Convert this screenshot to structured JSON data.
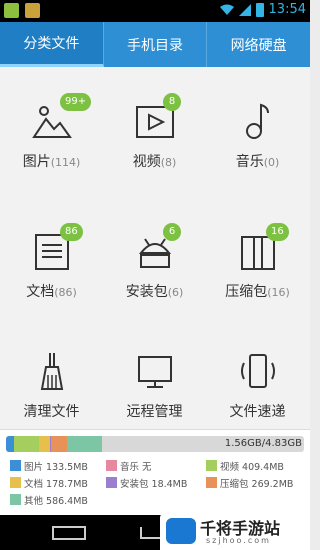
{
  "status_bar": {
    "time": "13:54",
    "icons": [
      "android-icon",
      "app-icon",
      "wifi-icon",
      "signal-icon",
      "battery-icon"
    ]
  },
  "tabs": [
    {
      "label": "分类文件",
      "active": true
    },
    {
      "label": "手机目录",
      "active": false
    },
    {
      "label": "网络硬盘",
      "active": false
    }
  ],
  "categories": [
    {
      "label": "图片",
      "count": "(114)",
      "badge": "99+",
      "icon": "image-icon"
    },
    {
      "label": "视频",
      "count": "(8)",
      "badge": "8",
      "icon": "video-icon"
    },
    {
      "label": "音乐",
      "count": "(0)",
      "badge": "",
      "icon": "music-icon"
    },
    {
      "label": "文档",
      "count": "(86)",
      "badge": "86",
      "icon": "document-icon"
    },
    {
      "label": "安装包",
      "count": "(6)",
      "badge": "6",
      "icon": "android-icon"
    },
    {
      "label": "压缩包",
      "count": "(16)",
      "badge": "16",
      "icon": "archive-icon"
    },
    {
      "label": "清理文件",
      "count": "",
      "badge": "",
      "icon": "broom-icon"
    },
    {
      "label": "远程管理",
      "count": "",
      "badge": "",
      "icon": "monitor-icon"
    },
    {
      "label": "文件速递",
      "count": "",
      "badge": "",
      "icon": "phone-transfer-icon"
    }
  ],
  "storage": {
    "total": "1.56GB/4.83GB",
    "used_fraction": 0.323,
    "legend": [
      {
        "label": "图片 133.5MB",
        "color": "#3a8fd6"
      },
      {
        "label": "音乐 无",
        "color": "#e888a0"
      },
      {
        "label": "视频 409.4MB",
        "color": "#a4cf5e"
      },
      {
        "label": "文档 178.7MB",
        "color": "#e6c04a"
      },
      {
        "label": "安装包 18.4MB",
        "color": "#9a7fd1"
      },
      {
        "label": "压缩包 269.2MB",
        "color": "#e8925a"
      },
      {
        "label": "其他 586.4MB",
        "color": "#7cc6a6"
      }
    ],
    "segments_mb": [
      133.5,
      0,
      409.4,
      178.7,
      18.4,
      269.2,
      586.4
    ],
    "capacity_mb": 4946
  },
  "colors": {
    "tab_bg": "#2e8fd4",
    "tab_active": "#1f7ec4",
    "badge": "#7cc142",
    "status_accent": "#33b5e5"
  },
  "watermark": {
    "title": "千将手游站",
    "sub": "szjhoo.com"
  }
}
